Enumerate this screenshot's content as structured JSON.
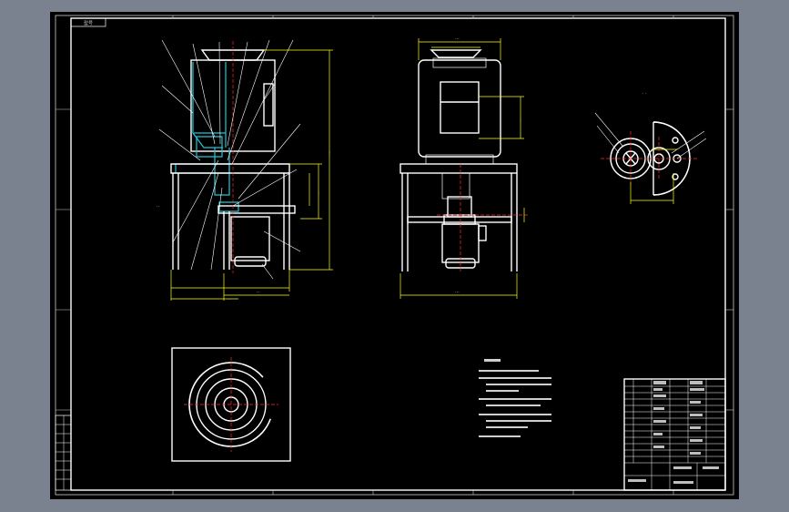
{
  "colors": {
    "viewport_bg": "#7a8290",
    "sheet_bg": "#000000",
    "line": "#ffffff",
    "dimension": "#ffff00",
    "centerline": "#ff2a2a",
    "section": "#22c6d8"
  },
  "title_block": {
    "label": "型号"
  },
  "icons": {
    "sheet": "drawing-sheet-icon"
  }
}
